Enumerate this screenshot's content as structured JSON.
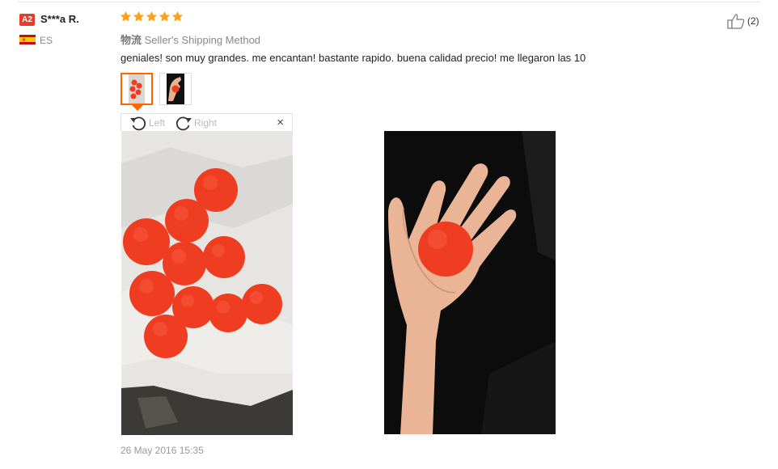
{
  "reviewer": {
    "level_badge": "A2",
    "name": "S***a R.",
    "country": "ES"
  },
  "review": {
    "rating": 5,
    "shipping_cn": "物流",
    "shipping_label": "Seller's Shipping Method",
    "comment": "geniales! son muy grandes. me encantan! bastante rapido. buena calidad precio! me llegaron las 10",
    "helpful_count": "(2)",
    "date": "26 May 2016 15:35"
  },
  "viewer": {
    "rotate_left": "Left",
    "rotate_right": "Right",
    "close": "×"
  },
  "icons": {
    "helpful": "thumbs-up-icon",
    "rotate_left": "rotate-left-icon",
    "rotate_right": "rotate-right-icon",
    "close": "close-icon",
    "star": "star-icon",
    "flag": "spain-flag-icon"
  },
  "colors": {
    "badge": "#e43d2c",
    "star": "#f7a21b",
    "accent": "#ff6600",
    "ball": "#ef3d22"
  }
}
